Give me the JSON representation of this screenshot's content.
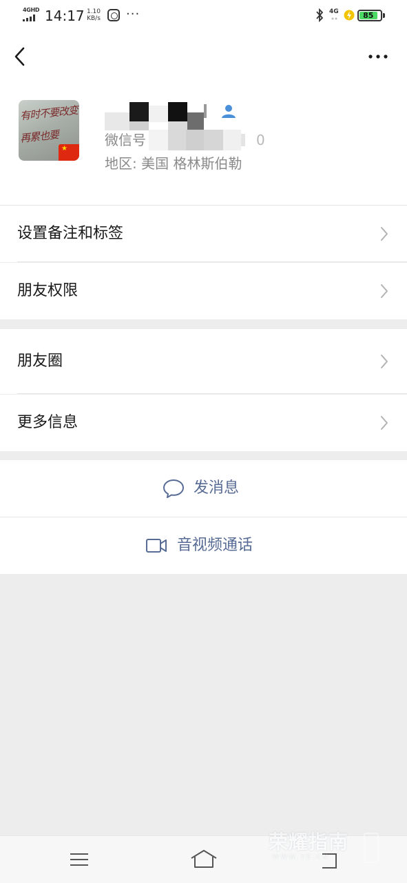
{
  "status_bar": {
    "network_label": "4GHD",
    "time": "14:17",
    "speed_value": "1.10",
    "speed_unit": "KB/s",
    "more_dots": "···",
    "mobile_label": "4G",
    "battery": "85",
    "battery_level": 0.85,
    "battery_color": "#4cd964"
  },
  "profile": {
    "wechat_id_label": "微信号",
    "wechat_id_suffix": "0",
    "region_label": "地区:  美国  格林斯伯勒"
  },
  "menu": {
    "remark_tags": "设置备注和标签",
    "friend_permissions": "朋友权限",
    "moments": "朋友圈",
    "more_info": "更多信息"
  },
  "actions": {
    "send_message": "发消息",
    "av_call": "音视频通话",
    "link_color": "#576b95"
  },
  "watermark": {
    "title": "荣耀指南",
    "url": "WWW.YE.CN"
  },
  "icons": {
    "back": "chevron-left-icon",
    "more": "more-dots-icon",
    "chevron": "chevron-right-icon",
    "message": "chat-bubble-icon",
    "video": "video-camera-icon",
    "contact": "contact-person-icon"
  }
}
